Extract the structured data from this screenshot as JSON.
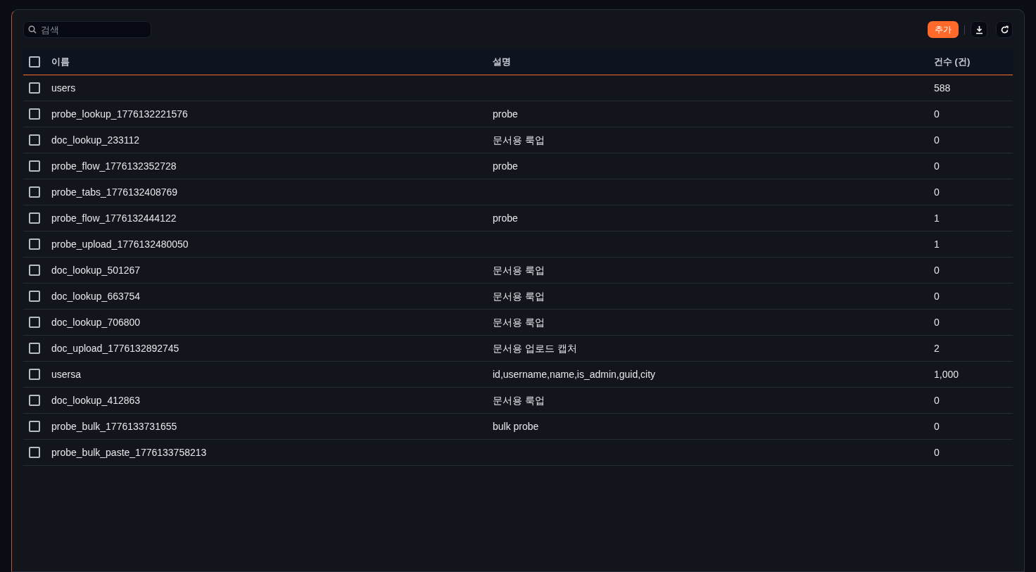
{
  "search": {
    "placeholder": "검색"
  },
  "toolbar": {
    "add_button": "추가"
  },
  "table": {
    "select_all": {
      "checked": false
    },
    "columns": [
      "이름",
      "설명",
      "건수 (건)"
    ],
    "rows": [
      {
        "checked": false,
        "name": "users",
        "description": "",
        "count": "588"
      },
      {
        "checked": false,
        "name": "probe_lookup_1776132221576",
        "description": "probe",
        "count": "0"
      },
      {
        "checked": false,
        "name": "doc_lookup_233112",
        "description": "문서용 룩업",
        "count": "0"
      },
      {
        "checked": false,
        "name": "probe_flow_1776132352728",
        "description": "probe",
        "count": "0"
      },
      {
        "checked": false,
        "name": "probe_tabs_1776132408769",
        "description": "",
        "count": "0"
      },
      {
        "checked": false,
        "name": "probe_flow_1776132444122",
        "description": "probe",
        "count": "1"
      },
      {
        "checked": false,
        "name": "probe_upload_1776132480050",
        "description": "",
        "count": "1"
      },
      {
        "checked": false,
        "name": "doc_lookup_501267",
        "description": "문서용 룩업",
        "count": "0"
      },
      {
        "checked": false,
        "name": "doc_lookup_663754",
        "description": "문서용 룩업",
        "count": "0"
      },
      {
        "checked": false,
        "name": "doc_lookup_706800",
        "description": "문서용 룩업",
        "count": "0"
      },
      {
        "checked": false,
        "name": "doc_upload_1776132892745",
        "description": "문서용 업로드 캡처",
        "count": "2"
      },
      {
        "checked": false,
        "name": "usersa",
        "description": "id,username,name,is_admin,guid,city",
        "count": "1,000"
      },
      {
        "checked": false,
        "name": "doc_lookup_412863",
        "description": "문서용 룩업",
        "count": "0"
      },
      {
        "checked": false,
        "name": "probe_bulk_1776133731655",
        "description": "bulk probe",
        "count": "0"
      },
      {
        "checked": false,
        "name": "probe_bulk_paste_1776133758213",
        "description": "",
        "count": "0"
      }
    ]
  }
}
